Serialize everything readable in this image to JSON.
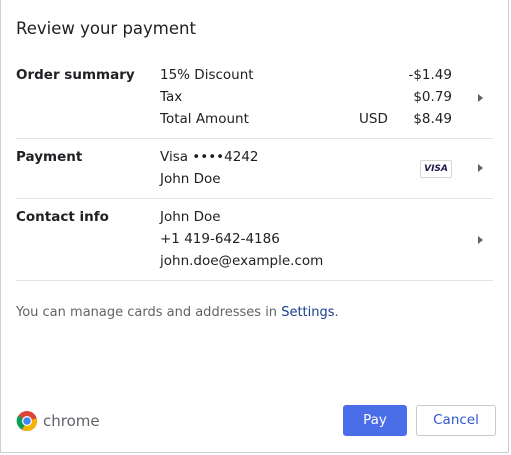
{
  "dialog": {
    "title": "Review your payment"
  },
  "order_summary": {
    "label": "Order summary",
    "items": [
      {
        "name": "15% Discount",
        "amount": "-$1.49"
      },
      {
        "name": "Tax",
        "amount": "$0.79"
      },
      {
        "name": "Total Amount",
        "currency": "USD",
        "amount": "$8.49"
      }
    ]
  },
  "payment": {
    "label": "Payment",
    "card": "Visa ••••4242",
    "name": "John Doe",
    "badge": "VISA"
  },
  "contact": {
    "label": "Contact info",
    "name": "John Doe",
    "phone": "+1 419-642-4186",
    "email": "john.doe@example.com"
  },
  "info": {
    "prefix": "You can manage cards and addresses in ",
    "link": "Settings",
    "suffix": "."
  },
  "footer": {
    "brand": "chrome",
    "pay_label": "Pay",
    "cancel_label": "Cancel"
  },
  "colors": {
    "accent": "#4a6ee8",
    "link": "#1a3d8f"
  },
  "icons": {
    "brand": "chrome-logo-icon",
    "row_arrow": "chevron-right-icon",
    "card_brand": "visa-icon"
  }
}
